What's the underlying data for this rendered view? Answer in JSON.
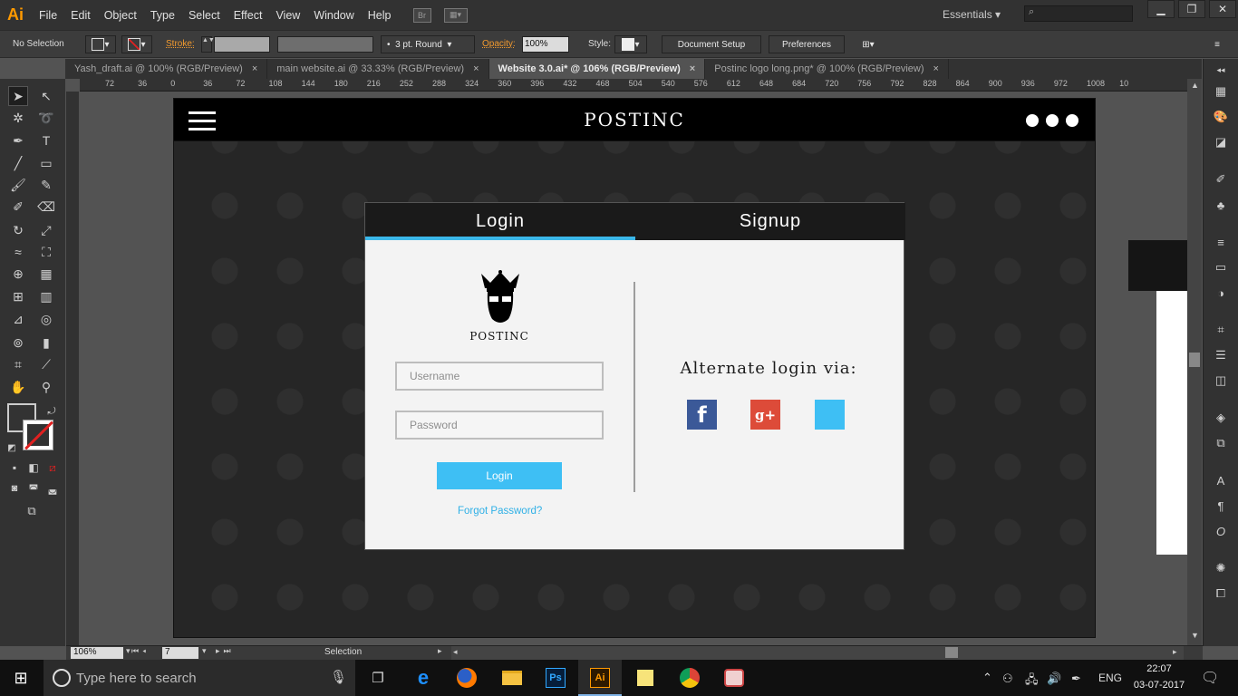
{
  "app": {
    "logo": "Ai"
  },
  "menu": [
    "File",
    "Edit",
    "Object",
    "Type",
    "Select",
    "Effect",
    "View",
    "Window",
    "Help"
  ],
  "menubar_icons": {
    "bridge": "Br"
  },
  "workspace": {
    "label": "Essentials"
  },
  "window_controls": {
    "minimize": "▁",
    "restore": "❐",
    "close": "✕"
  },
  "control_bar": {
    "selection": "No Selection",
    "stroke_label": "Stroke:",
    "brush": "3 pt. Round",
    "opacity_label": "Opacity:",
    "opacity_value": "100%",
    "style_label": "Style:",
    "document_setup": "Document Setup",
    "preferences": "Preferences"
  },
  "tabs": [
    {
      "label": "Yash_draft.ai @ 100% (RGB/Preview)",
      "close": "×"
    },
    {
      "label": "main website.ai @ 33.33% (RGB/Preview)",
      "close": "×"
    },
    {
      "label": "Website 3.0.ai* @ 106% (RGB/Preview)",
      "close": "×",
      "active": true
    },
    {
      "label": "Postinc logo  long.png* @ 100% (RGB/Preview)",
      "close": "×"
    }
  ],
  "ruler_labels": [
    "72",
    "36",
    "0",
    "36",
    "72",
    "108",
    "144",
    "180",
    "216",
    "252",
    "288",
    "324",
    "360",
    "396",
    "432",
    "468",
    "504",
    "540",
    "576",
    "612",
    "648",
    "684",
    "720",
    "756",
    "792",
    "828",
    "864",
    "900",
    "936",
    "972",
    "1008",
    "10"
  ],
  "status": {
    "zoom": "106%",
    "artboard_num": "7",
    "tool": "Selection"
  },
  "site": {
    "title": "POSTINC",
    "tabs": {
      "login": "Login",
      "signup": "Signup"
    },
    "logo_text": "POSTINC",
    "username_placeholder": "Username",
    "password_placeholder": "Password",
    "login_button": "Login",
    "forgot_password": "Forgot Password?",
    "alternate_login": "Alternate login via:",
    "social": {
      "facebook": "f",
      "google": "g+"
    }
  },
  "taskbar": {
    "search_placeholder": "Type here to search",
    "language": "ENG",
    "time": "22:07",
    "date": "03-07-2017",
    "apps": {
      "ps": "Ps",
      "ai": "Ai"
    }
  },
  "colors": {
    "accent": "#3bb8ea",
    "ai_orange": "#ff9a00",
    "facebook": "#3b5998",
    "google": "#dd4b39",
    "twitter": "#3ebff4"
  }
}
